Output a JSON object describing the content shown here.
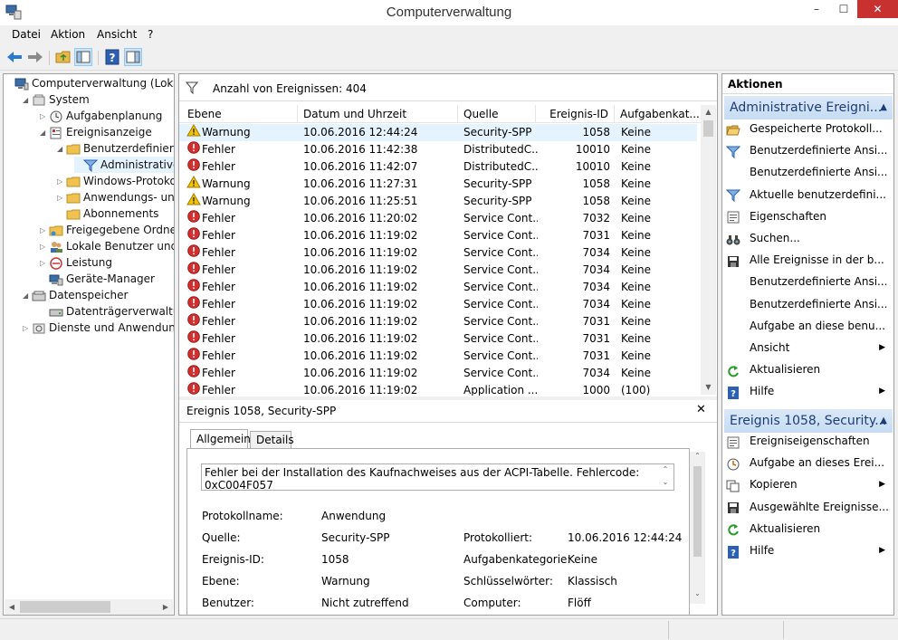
{
  "window": {
    "title": "Computerverwaltung",
    "minimize": "–",
    "maximize": "☐",
    "close": "✕"
  },
  "menu": [
    "Datei",
    "Aktion",
    "Ansicht",
    "?"
  ],
  "tree": [
    {
      "label": "Computerverwaltung (Lokal)",
      "level": 0,
      "expander": "",
      "icon": "computer-icon"
    },
    {
      "label": "System",
      "level": 1,
      "expander": "◢",
      "icon": "tools-icon"
    },
    {
      "label": "Aufgabenplanung",
      "level": 2,
      "expander": "▷",
      "icon": "clock-icon"
    },
    {
      "label": "Ereignisanzeige",
      "level": 2,
      "expander": "◢",
      "icon": "event-viewer-icon"
    },
    {
      "label": "Benutzerdefinierte A",
      "level": 3,
      "expander": "◢",
      "icon": "folder-icon"
    },
    {
      "label": "Administrative E",
      "level": 4,
      "expander": "",
      "icon": "filter-icon",
      "selected": true
    },
    {
      "label": "Windows-Protokolle",
      "level": 3,
      "expander": "▷",
      "icon": "folder-icon"
    },
    {
      "label": "Anwendungs- und D",
      "level": 3,
      "expander": "▷",
      "icon": "folder-icon"
    },
    {
      "label": "Abonnements",
      "level": 3,
      "expander": "",
      "icon": "folder-icon"
    },
    {
      "label": "Freigegebene Ordner",
      "level": 2,
      "expander": "▷",
      "icon": "shared-folder-icon"
    },
    {
      "label": "Lokale Benutzer und Gru",
      "level": 2,
      "expander": "▷",
      "icon": "users-icon"
    },
    {
      "label": "Leistung",
      "level": 2,
      "expander": "▷",
      "icon": "performance-icon"
    },
    {
      "label": "Geräte-Manager",
      "level": 2,
      "expander": "",
      "icon": "device-manager-icon"
    },
    {
      "label": "Datenspeicher",
      "level": 1,
      "expander": "◢",
      "icon": "storage-icon"
    },
    {
      "label": "Datenträgerverwaltung",
      "level": 2,
      "expander": "",
      "icon": "disk-icon"
    },
    {
      "label": "Dienste und Anwendungen",
      "level": 1,
      "expander": "▷",
      "icon": "services-icon"
    }
  ],
  "list": {
    "count_label": "Anzahl von Ereignissen: 404",
    "columns": [
      "Ebene",
      "Datum und Uhrzeit",
      "Quelle",
      "Ereignis-ID",
      "Aufgabenkat..."
    ],
    "rows": [
      {
        "level": "Warnung",
        "type": "warning",
        "date": "10.06.2016 12:44:24",
        "source": "Security-SPP",
        "id": "1058",
        "task": "Keine"
      },
      {
        "level": "Fehler",
        "type": "error",
        "date": "10.06.2016 11:42:38",
        "source": "DistributedC...",
        "id": "10010",
        "task": "Keine"
      },
      {
        "level": "Fehler",
        "type": "error",
        "date": "10.06.2016 11:42:07",
        "source": "DistributedC...",
        "id": "10010",
        "task": "Keine"
      },
      {
        "level": "Warnung",
        "type": "warning",
        "date": "10.06.2016 11:27:31",
        "source": "Security-SPP",
        "id": "1058",
        "task": "Keine"
      },
      {
        "level": "Warnung",
        "type": "warning",
        "date": "10.06.2016 11:25:51",
        "source": "Security-SPP",
        "id": "1058",
        "task": "Keine"
      },
      {
        "level": "Fehler",
        "type": "error",
        "date": "10.06.2016 11:20:02",
        "source": "Service Cont...",
        "id": "7032",
        "task": "Keine"
      },
      {
        "level": "Fehler",
        "type": "error",
        "date": "10.06.2016 11:19:02",
        "source": "Service Cont...",
        "id": "7031",
        "task": "Keine"
      },
      {
        "level": "Fehler",
        "type": "error",
        "date": "10.06.2016 11:19:02",
        "source": "Service Cont...",
        "id": "7034",
        "task": "Keine"
      },
      {
        "level": "Fehler",
        "type": "error",
        "date": "10.06.2016 11:19:02",
        "source": "Service Cont...",
        "id": "7034",
        "task": "Keine"
      },
      {
        "level": "Fehler",
        "type": "error",
        "date": "10.06.2016 11:19:02",
        "source": "Service Cont...",
        "id": "7034",
        "task": "Keine"
      },
      {
        "level": "Fehler",
        "type": "error",
        "date": "10.06.2016 11:19:02",
        "source": "Service Cont...",
        "id": "7034",
        "task": "Keine"
      },
      {
        "level": "Fehler",
        "type": "error",
        "date": "10.06.2016 11:19:02",
        "source": "Service Cont...",
        "id": "7031",
        "task": "Keine"
      },
      {
        "level": "Fehler",
        "type": "error",
        "date": "10.06.2016 11:19:02",
        "source": "Service Cont...",
        "id": "7031",
        "task": "Keine"
      },
      {
        "level": "Fehler",
        "type": "error",
        "date": "10.06.2016 11:19:02",
        "source": "Service Cont...",
        "id": "7031",
        "task": "Keine"
      },
      {
        "level": "Fehler",
        "type": "error",
        "date": "10.06.2016 11:19:02",
        "source": "Service Cont...",
        "id": "7034",
        "task": "Keine"
      },
      {
        "level": "Fehler",
        "type": "error",
        "date": "10.06.2016 11:19:02",
        "source": "Application ...",
        "id": "1000",
        "task": "(100)"
      }
    ]
  },
  "detail": {
    "title": "Ereignis 1058, Security-SPP",
    "tabs": [
      "Allgemein",
      "Details"
    ],
    "message": "Fehler bei der Installation des Kaufnachweises aus der ACPI-Tabelle. Fehlercode: 0xC004F057",
    "fields": {
      "protokollname_label": "Protokollname:",
      "protokollname": "Anwendung",
      "quelle_label": "Quelle:",
      "quelle": "Security-SPP",
      "protokolliert_label": "Protokolliert:",
      "protokolliert": "10.06.2016 12:44:24",
      "ereignis_id_label": "Ereignis-ID:",
      "ereignis_id": "1058",
      "aufgabenkategorie_label": "Aufgabenkategorie:",
      "aufgabenkategorie": "Keine",
      "ebene_label": "Ebene:",
      "ebene": "Warnung",
      "schluesselwoerter_label": "Schlüsselwörter:",
      "schluesselwoerter": "Klassisch",
      "benutzer_label": "Benutzer:",
      "benutzer": "Nicht zutreffend",
      "computer_label": "Computer:",
      "computer": "Flöff"
    }
  },
  "actions": {
    "title": "Aktionen",
    "section1": "Administrative Ereigni...",
    "section1_items": [
      {
        "label": "Gespeicherte Protokoll...",
        "icon": "open-folder-icon"
      },
      {
        "label": "Benutzerdefinierte Ansi...",
        "icon": "filter-icon"
      },
      {
        "label": "Benutzerdefinierte Ansi...",
        "icon": ""
      },
      {
        "label": "Aktuelle benutzerdefini...",
        "icon": "filter-icon"
      },
      {
        "label": "Eigenschaften",
        "icon": "properties-icon"
      },
      {
        "label": "Suchen...",
        "icon": "binoculars-icon"
      },
      {
        "label": "Alle Ereignisse in der b...",
        "icon": "save-icon"
      },
      {
        "label": "Benutzerdefinierte Ansi...",
        "icon": ""
      },
      {
        "label": "Benutzerdefinierte Ansi...",
        "icon": ""
      },
      {
        "label": "Aufgabe an diese benu...",
        "icon": ""
      },
      {
        "label": "Ansicht",
        "icon": "",
        "submenu": true
      },
      {
        "label": "Aktualisieren",
        "icon": "refresh-icon"
      },
      {
        "label": "Hilfe",
        "icon": "help-icon",
        "submenu": true
      }
    ],
    "section2": "Ereignis 1058, Security...",
    "section2_items": [
      {
        "label": "Ereigniseigenschaften",
        "icon": "properties-icon"
      },
      {
        "label": "Aufgabe an dieses Erei...",
        "icon": "task-icon"
      },
      {
        "label": "Kopieren",
        "icon": "copy-icon",
        "submenu": true
      },
      {
        "label": "Ausgewählte Ereignisse...",
        "icon": "save-icon"
      },
      {
        "label": "Aktualisieren",
        "icon": "refresh-icon"
      },
      {
        "label": "Hilfe",
        "icon": "help-icon",
        "submenu": true
      }
    ]
  },
  "colors": {
    "selection": "#e5f3ff",
    "actions_header": "#1e3c78",
    "error": "#d32f2f",
    "warning": "#f5c400",
    "accent": "#2d6bb3"
  }
}
